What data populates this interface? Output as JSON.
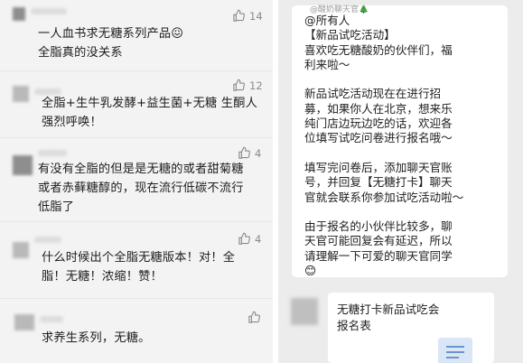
{
  "left_panel": {
    "comments": [
      {
        "text": "一人血书求无糖系列产品😖\n全脂真的没关系",
        "likes": "14"
      },
      {
        "text": "全脂+生牛乳发酵+益生菌+无糖  生酮人\n强烈呼唤！",
        "likes": "12"
      },
      {
        "text": "有没有全脂的但是是无糖的或者甜菊糖\n或者赤藓糖醇的，现在流行低碳不流行\n低脂了",
        "likes": "4"
      },
      {
        "text": "什么时候出个全脂无糖版本！对！全\n脂！无糖！浓缩！赞！",
        "likes": "4"
      },
      {
        "text": "求养生系列，无糖。",
        "likes": ""
      }
    ]
  },
  "right_panel": {
    "group_tag": "@酸奶聊天官🎄",
    "announcement": "@所有人\n【新品试吃活动】\n喜欢吃无糖酸奶的伙伴们，福\n利来啦～\n\n新品试吃活动现在在进行招\n募，如果你人在北京，想来乐\n纯门店边玩边吃的话，欢迎各\n位填写试吃问卷进行报名哦～\n\n填写完问卷后，添加聊天官账\n号，并回复【无糖打卡】聊天\n官就会联系你参加试吃活动啦～\n\n由于报名的小伙伴比较多，聊\n天官可能回复会有延迟，所以\n请理解一下可爱的聊天官同学\n😊",
    "card_title": "无糖打卡新品试吃会报名表"
  },
  "colors": {
    "left_bg": "#f3f3f3",
    "right_bg": "#ececec",
    "bubble_bg": "#ffffff",
    "icon_gray": "#8a8a8a"
  }
}
